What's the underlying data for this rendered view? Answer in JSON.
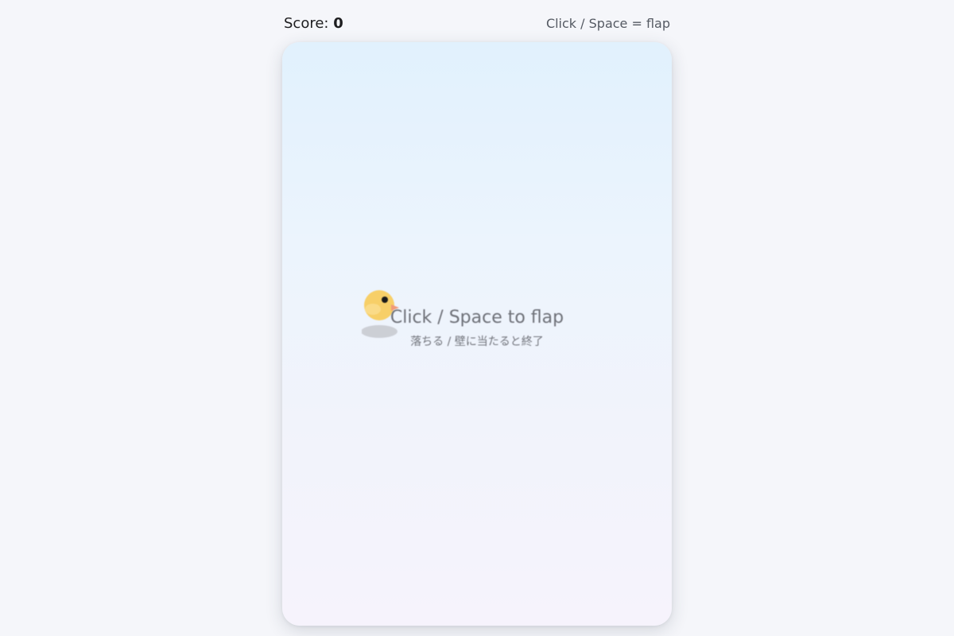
{
  "header": {
    "score_label": "Score:",
    "score_value": "0",
    "controls_hint": "Click / Space = flap"
  },
  "game": {
    "start_title": "Click / Space to flap",
    "start_subtitle": "落ちる / 壁に当たると終了",
    "colors": {
      "sky_top": "#e1f1fd",
      "sky_bottom": "#f6f3fc",
      "bird_body": "#f7cf68",
      "bird_beak": "#f19a7a",
      "bird_eye": "#1a1a1a",
      "shadow": "#c5c8ce"
    },
    "bird_icon": "chick-icon"
  }
}
